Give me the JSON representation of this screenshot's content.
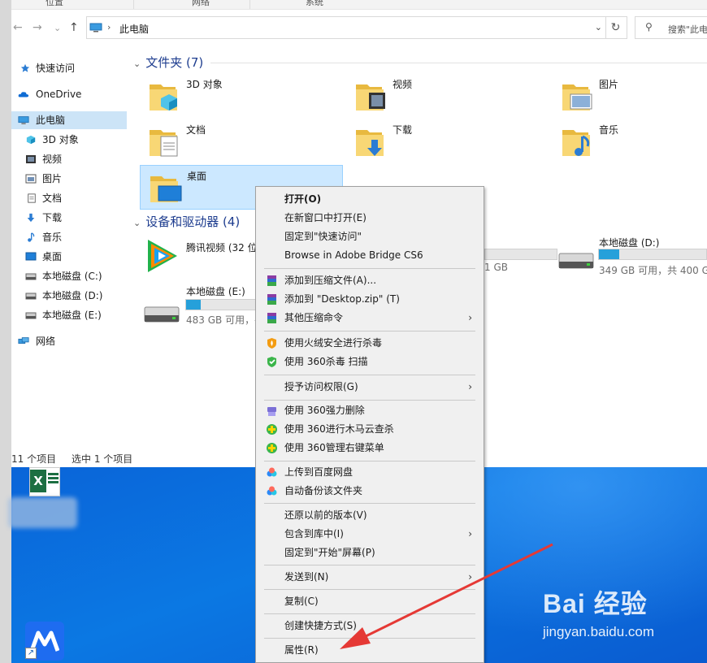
{
  "ribbon": {
    "tabs": [
      "位置",
      "网络",
      "系统"
    ]
  },
  "address": {
    "path": "此电脑",
    "search_placeholder": "搜索\"此电"
  },
  "sidebar": {
    "items": [
      {
        "label": "快速访问",
        "icon": "star-icon"
      },
      {
        "label": "OneDrive",
        "icon": "cloud-icon"
      },
      {
        "label": "此电脑",
        "icon": "computer-icon"
      },
      {
        "label": "3D 对象",
        "icon": "cube-icon"
      },
      {
        "label": "视频",
        "icon": "video-icon"
      },
      {
        "label": "图片",
        "icon": "picture-icon"
      },
      {
        "label": "文档",
        "icon": "document-icon"
      },
      {
        "label": "下载",
        "icon": "download-icon"
      },
      {
        "label": "音乐",
        "icon": "music-icon"
      },
      {
        "label": "桌面",
        "icon": "desktop-icon"
      },
      {
        "label": "本地磁盘 (C:)",
        "icon": "drive-icon"
      },
      {
        "label": "本地磁盘 (D:)",
        "icon": "drive-icon"
      },
      {
        "label": "本地磁盘 (E:)",
        "icon": "drive-icon"
      },
      {
        "label": "网络",
        "icon": "network-icon"
      }
    ]
  },
  "folders": {
    "title": "文件夹 (7)",
    "items": [
      "3D 对象",
      "视频",
      "图片",
      "文档",
      "下载",
      "音乐",
      "桌面"
    ]
  },
  "drives": {
    "title": "设备和驱动器 (4)",
    "items": [
      {
        "name": "腾讯视频 (32 位",
        "info": ""
      },
      {
        "name": "",
        "info": "1 GB",
        "fill": 0.0
      },
      {
        "name": "本地磁盘 (D:)",
        "info": "349 GB 可用，共 400 G",
        "fill": 0.13
      },
      {
        "name": "本地磁盘 (E:)",
        "info": "483 GB 可用，共",
        "fill": 0.08
      }
    ]
  },
  "status": {
    "count": "11 个项目",
    "selected": "选中 1 个项目"
  },
  "context_menu": {
    "items": [
      {
        "label": "打开(O)"
      },
      {
        "label": "在新窗口中打开(E)"
      },
      {
        "label": "固定到\"快速访问\""
      },
      {
        "label": "Browse in Adobe Bridge CS6"
      },
      {
        "label": "添加到压缩文件(A)..."
      },
      {
        "label": "添加到 \"Desktop.zip\" (T)"
      },
      {
        "label": "其他压缩命令"
      },
      {
        "label": "使用火绒安全进行杀毒"
      },
      {
        "label": "使用 360杀毒 扫描"
      },
      {
        "label": "授予访问权限(G)"
      },
      {
        "label": "使用 360强力删除"
      },
      {
        "label": "使用 360进行木马云查杀"
      },
      {
        "label": "使用 360管理右键菜单"
      },
      {
        "label": "上传到百度网盘"
      },
      {
        "label": "自动备份该文件夹"
      },
      {
        "label": "还原以前的版本(V)"
      },
      {
        "label": "包含到库中(I)"
      },
      {
        "label": "固定到\"开始\"屏幕(P)"
      },
      {
        "label": "发送到(N)"
      },
      {
        "label": "复制(C)"
      },
      {
        "label": "创建快捷方式(S)"
      },
      {
        "label": "属性(R)"
      }
    ],
    "submenu_glyph": "›"
  },
  "watermark": {
    "brand": "Bai 经验",
    "url": "jingyan.baidu.com"
  },
  "colors": {
    "accent": "#0078d7",
    "selection": "#cce8ff",
    "drive_fill": "#26a0da",
    "annotation": "#e53935"
  }
}
